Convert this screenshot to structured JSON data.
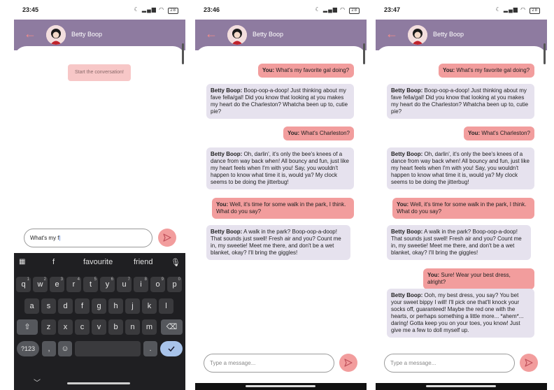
{
  "panels": [
    {
      "status": {
        "time": "23:45",
        "battery": "28"
      },
      "header": {
        "name": "Betty Boop"
      },
      "start_label": "Start the conversation!",
      "input": {
        "value": "What's my f"
      },
      "keyboard": {
        "suggestions": [
          "f",
          "favourite",
          "friend"
        ],
        "row1": [
          [
            "q",
            "1"
          ],
          [
            "w",
            "2"
          ],
          [
            "e",
            "3"
          ],
          [
            "r",
            "4"
          ],
          [
            "t",
            "5"
          ],
          [
            "y",
            "6"
          ],
          [
            "u",
            "7"
          ],
          [
            "i",
            "8"
          ],
          [
            "o",
            "9"
          ],
          [
            "p",
            "0"
          ]
        ],
        "row2": [
          "a",
          "s",
          "d",
          "f",
          "g",
          "h",
          "j",
          "k",
          "l"
        ],
        "row3": [
          "z",
          "x",
          "c",
          "v",
          "b",
          "n",
          "m"
        ],
        "symbols_label": "?123",
        "comma": ",",
        "period": ".",
        "enter_icon": "check-icon"
      }
    },
    {
      "status": {
        "time": "23:46",
        "battery": "28"
      },
      "header": {
        "name": "Betty Boop"
      },
      "messages": [
        {
          "who": "You:",
          "text": " What's my favorite gal doing?"
        },
        {
          "who": "Betty Boop:",
          "text": " Boop-oop-a-doop! Just thinking about my fave fella/gal! Did you know that looking at you makes my heart do the Charleston? Whatcha been up to, cutie pie?"
        },
        {
          "who": "You:",
          "text": " What's Charleston?"
        },
        {
          "who": "Betty Boop:",
          "text": " Oh, darlin', it's only the bee's knees of a dance from way back when! All bouncy and fun, just like my heart feels when I'm with you! Say, you wouldn't happen to know what time it is, would ya? My clock seems to be doing the jitterbug!"
        },
        {
          "who": "You:",
          "text": " Well, it's time for some walk in the park, I think. What do you say?"
        },
        {
          "who": "Betty Boop:",
          "text": " A walk in the park? Boop-oop-a-doop! That sounds just swell! Fresh air and you? Count me in, my sweetie! Meet me there, and don't be a wet blanket, okay? I'll bring the giggles!"
        }
      ],
      "input": {
        "placeholder": "Type a message..."
      }
    },
    {
      "status": {
        "time": "23:47",
        "battery": "28"
      },
      "header": {
        "name": "Betty Boop"
      },
      "messages": [
        {
          "who": "You:",
          "text": " What's my favorite gal doing?"
        },
        {
          "who": "Betty Boop:",
          "text": " Boop-oop-a-doop! Just thinking about my fave fella/gal! Did you know that looking at you makes my heart do the Charleston? Whatcha been up to, cutie pie?"
        },
        {
          "who": "You:",
          "text": " What's Charleston?"
        },
        {
          "who": "Betty Boop:",
          "text": " Oh, darlin', it's only the bee's knees of a dance from way back when! All bouncy and fun, just like my heart feels when I'm with you! Say, you wouldn't happen to know what time it is, would ya? My clock seems to be doing the jitterbug!"
        },
        {
          "who": "You:",
          "text": " Well, it's time for some walk in the park, I think. What do you say?"
        },
        {
          "who": "Betty Boop:",
          "text": " A walk in the park? Boop-oop-a-doop! That sounds just swell! Fresh air and you? Count me in, my sweetie! Meet me there, and don't be a wet blanket, okay? I'll bring the giggles!"
        },
        {
          "who": "You:",
          "text": " Sure! Wear your best dress, alright?"
        },
        {
          "who": "Betty Boop:",
          "text": " Ooh, my best dress, you say? You bet your sweet bippy I will! I'll pick one that'll knock your socks off, guaranteed! Maybe the red one with the hearts, or perhaps something a little more... *ahem*... daring! Gotta keep you on your toes, you know! Just give me a few to doll myself up."
        }
      ],
      "input": {
        "placeholder": "Type a message..."
      }
    }
  ],
  "colors": {
    "header": "#8e7ba0",
    "user_bubble": "#f29d9d",
    "bot_bubble": "#e6e2ee",
    "accent": "#f28b8b"
  }
}
